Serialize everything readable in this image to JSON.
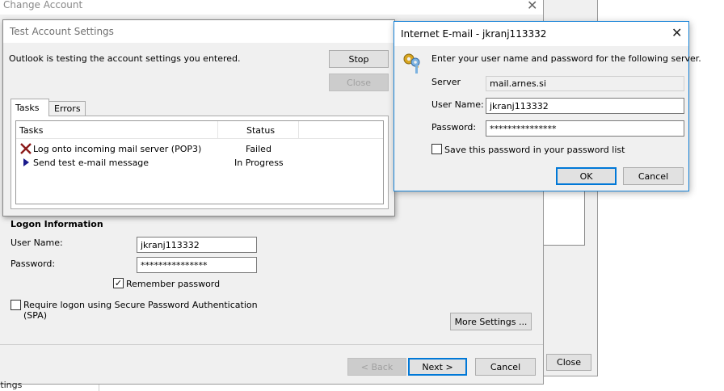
{
  "right_bg": {
    "close_label": "Close"
  },
  "change_account": {
    "title": "Change Account",
    "logon_heading": "Logon Information",
    "user_name_label": "User Name:",
    "user_name_value": "jkranj113332",
    "password_label": "Password:",
    "password_value": "***************",
    "remember_label": "Remember password",
    "spa_label_line1": "Require logon using Secure Password Authentication",
    "spa_label_line2": "(SPA)",
    "more_settings_label": "More Settings ...",
    "back_label": "< Back",
    "next_label": "Next >",
    "cancel_label": "Cancel",
    "bottom_fragment": "ttings"
  },
  "test_settings": {
    "title": "Test Account Settings",
    "message": "Outlook is testing the account settings you entered.",
    "stop_label": "Stop",
    "close_label": "Close",
    "tabs": [
      "Tasks",
      "Errors"
    ],
    "columns": [
      "Tasks",
      "Status"
    ],
    "rows": [
      {
        "task": "Log onto incoming mail server (POP3)",
        "status": "Failed"
      },
      {
        "task": "Send test e-mail message",
        "status": "In Progress"
      }
    ]
  },
  "internet_email": {
    "title": "Internet E-mail - jkranj113332",
    "prompt": "Enter your user name and password for the following server.",
    "server_label": "Server",
    "server_value": "mail.arnes.si",
    "user_name_label": "User Name:",
    "user_name_value": "jkranj113332",
    "password_label": "Password:",
    "password_value": "***************",
    "save_label": "Save this password in your password list",
    "ok_label": "OK",
    "cancel_label": "Cancel"
  },
  "colors": {
    "accent": "#0078d7",
    "failed": "#8b1a1a",
    "progress": "#1a1a8b"
  }
}
